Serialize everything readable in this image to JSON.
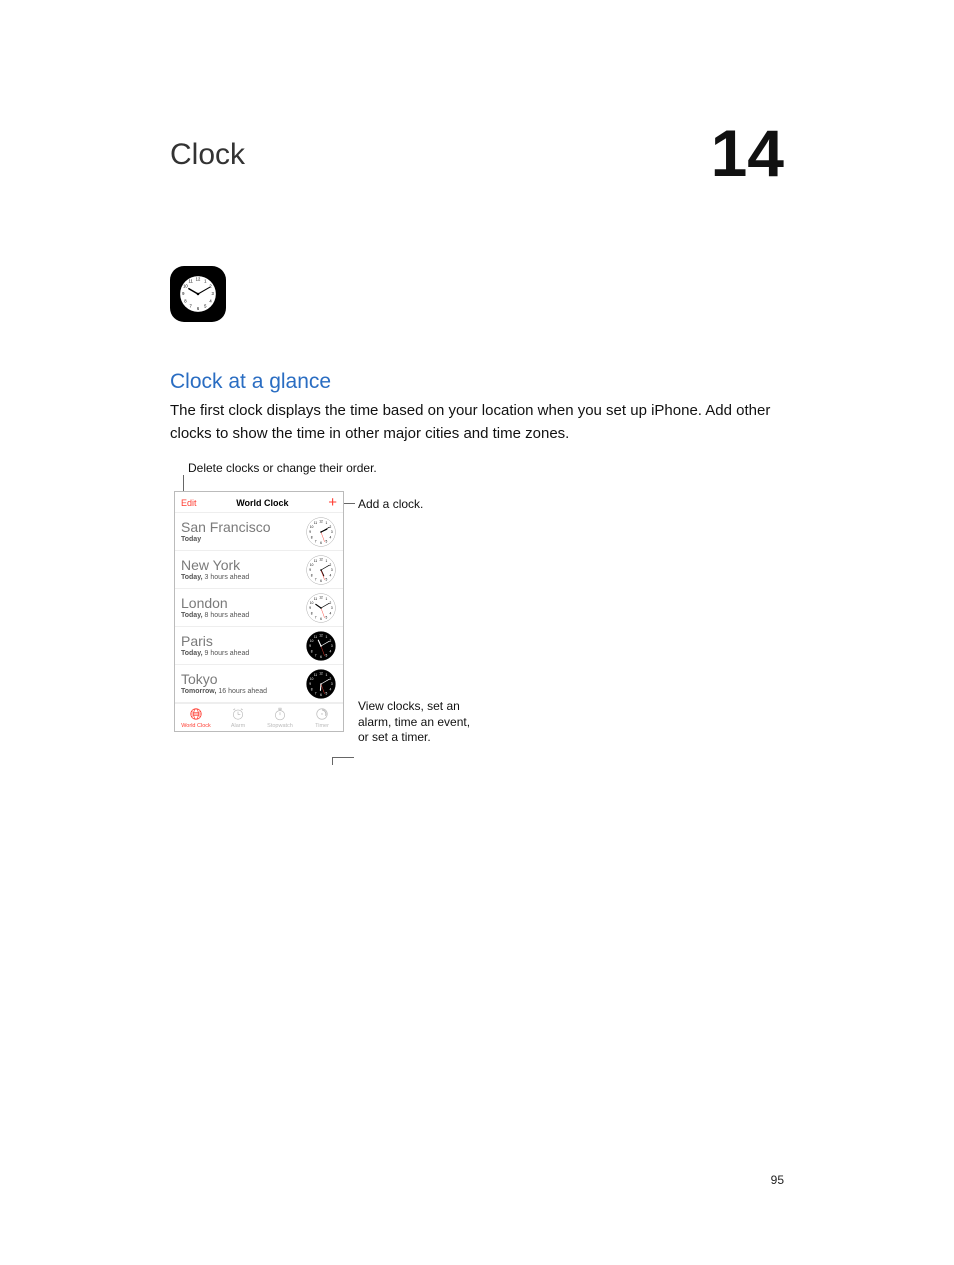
{
  "chapter": {
    "title": "Clock",
    "number": "14"
  },
  "section": {
    "heading": "Clock at a glance",
    "body": "The first clock displays the time based on your location when you set up iPhone. Add other clocks to show the time in other major cities and time zones."
  },
  "callouts": {
    "top": "Delete clocks or change their order.",
    "add": "Add a clock.",
    "view": "View clocks, set an alarm, time an event, or set a timer."
  },
  "device": {
    "editLabel": "Edit",
    "title": "World Clock",
    "addLabel": "+",
    "cities": [
      {
        "name": "San Francisco",
        "day": "Today",
        "ahead": "",
        "face": "light",
        "hour": 2,
        "minute": 10
      },
      {
        "name": "New York",
        "day": "Today,",
        "ahead": " 3 hours ahead",
        "face": "light",
        "hour": 5,
        "minute": 10
      },
      {
        "name": "London",
        "day": "Today,",
        "ahead": " 8 hours ahead",
        "face": "light",
        "hour": 10,
        "minute": 10
      },
      {
        "name": "Paris",
        "day": "Today,",
        "ahead": " 9 hours ahead",
        "face": "dark",
        "hour": 11,
        "minute": 10
      },
      {
        "name": "Tokyo",
        "day": "Tomorrow,",
        "ahead": " 16 hours ahead",
        "face": "dark",
        "hour": 6,
        "minute": 10
      }
    ],
    "tabs": [
      {
        "label": "World Clock",
        "active": true,
        "icon": "globe"
      },
      {
        "label": "Alarm",
        "active": false,
        "icon": "alarm"
      },
      {
        "label": "Stopwatch",
        "active": false,
        "icon": "stopwatch"
      },
      {
        "label": "Timer",
        "active": false,
        "icon": "timer"
      }
    ]
  },
  "pageNumber": "95"
}
